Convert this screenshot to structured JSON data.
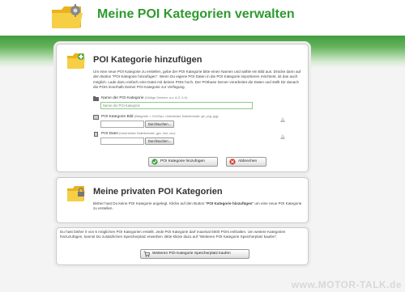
{
  "header": {
    "title": "Meine POI Kategorien verwalten"
  },
  "add_panel": {
    "title": "POI Kategorie hinzufügen",
    "intro": "Um eine neue POI Kategorie zu erstellen, gebe der POI Kategorie bitte einen Namen und wähle ein Bild aus. Drücke dann auf den Button \"POI Kategorie hinzufügen\". Wenn Du eigene POI Daten in die POI Kategorie importieren möchtest, ist das auch möglich. Lade dazu einfach eine Datei mit deinen POIs hoch. Der POIbase Server verarbeitet die Daten und stellt Dir danach die POIs innerhalb Deiner POI Kategorie zur Verfügung.",
    "name_field": {
      "label": "Name der POI Kategorie",
      "hint": "(Gültige Zeichen: a-z, A-Z, 0-9)",
      "placeholder": "Name der POI Kategorie"
    },
    "image_field": {
      "label": "POI Kategorie Bild",
      "hint": "(Bildgröße < 22x22px, Unterstütze Dateiformate: gif, png, jpg):",
      "browse_label": "Durchsuchen..."
    },
    "file_field": {
      "label": "POI Datei",
      "hint": "(Unterstütze Dateiformate: gpx, kml, csv):",
      "browse_label": "Durchsuchen..."
    },
    "submit_label": "POI Kategorie hinzufügen",
    "cancel_label": "Abbrechen"
  },
  "private_panel": {
    "title": "Meine privaten POI Kategorien",
    "text_before": "Bisher hast Du keine POI Kategorie angelegt. Klicke auf den Button \"",
    "text_bold": "POI Kategorie hinzufügen",
    "text_after": "\" um eine neue POI Kategorie zu erstellen."
  },
  "info_panel": {
    "text": "Du hast bisher 0 von 5 möglichen POI Kategorien erstellt. Jede POI Kategorie darf maximal 5000 POIs enthalten. Um weitere Kategorien hinzuzufügen, kannst Du zusätzlichen Speicherplatz erwerben. Bitte klicke dazu auf \"Weiteren POI Kategorie Speicherplatz kaufen\".",
    "buy_label": "Weiteren POI Kategorie Speicherplatz kaufen"
  },
  "watermark": "www.MOTOR-TALK.de",
  "colors": {
    "accent_green": "#2e9a2e",
    "folder_yellow": "#f2c230",
    "cancel_red": "#d23a2a"
  },
  "icons": [
    "folder-settings-icon",
    "folder-add-icon",
    "folder-private-icon",
    "folder-small-icon",
    "image-icon",
    "file-icon",
    "help-icon",
    "check-icon",
    "cancel-icon",
    "cart-icon"
  ]
}
